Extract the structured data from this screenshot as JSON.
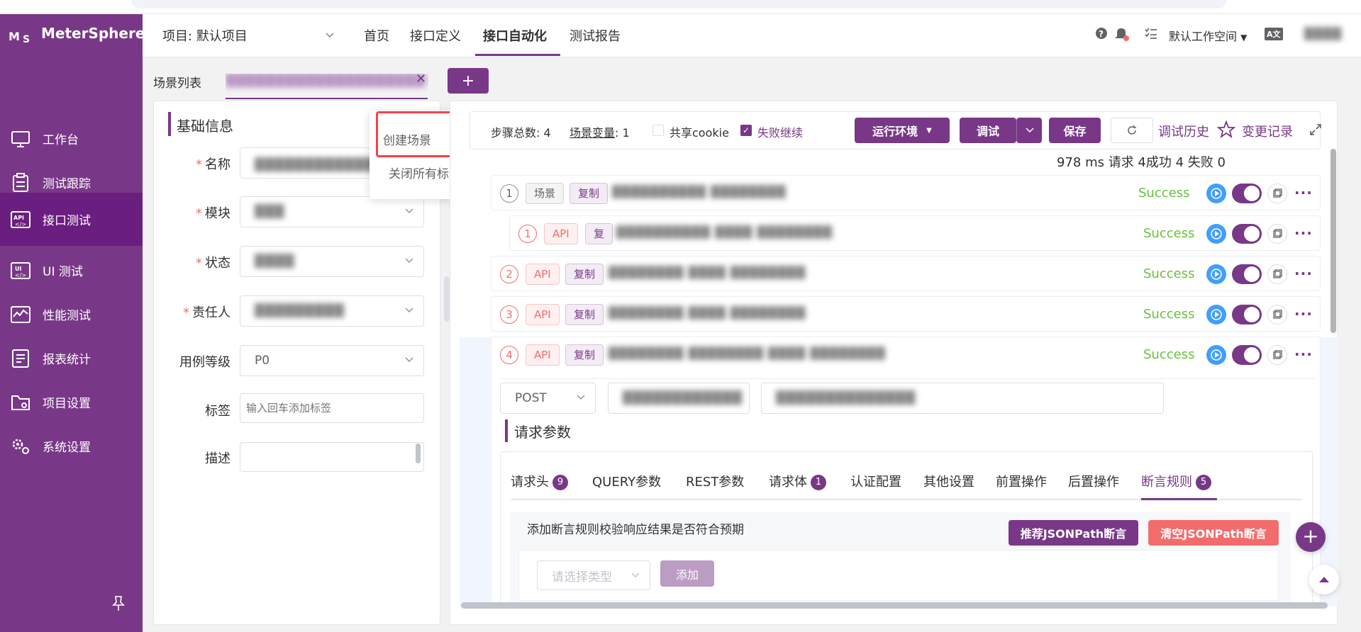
{
  "app": {
    "name": "MeterSphere"
  },
  "topnav": {
    "project": "项目: 默认项目",
    "tabs": [
      "首页",
      "接口定义",
      "接口自动化",
      "测试报告"
    ],
    "active_tab": "接口自动化",
    "workspace": "默认工作空间",
    "lang_icon": "A文",
    "user": "████"
  },
  "sidebar": {
    "items": [
      {
        "label": "工作台",
        "icon": "monitor-icon"
      },
      {
        "label": "测试跟踪",
        "icon": "clipboard-icon"
      },
      {
        "label": "接口测试",
        "icon": "api-icon",
        "active": true
      },
      {
        "label": "UI 测试",
        "icon": "ui-icon"
      },
      {
        "label": "性能测试",
        "icon": "performance-icon"
      },
      {
        "label": "报表统计",
        "icon": "report-icon"
      },
      {
        "label": "项目设置",
        "icon": "folder-icon"
      },
      {
        "label": "系统设置",
        "icon": "settings-icon"
      }
    ]
  },
  "tabs": {
    "scene_list": "场景列表",
    "open_tab_label": "████████████████████3",
    "add": "+"
  },
  "context_menu": {
    "create_scene": "创建场景",
    "close_all": "关闭所有标签"
  },
  "form": {
    "section_title": "基础信息",
    "name_label": "名称",
    "name_value": "████████████提",
    "module_label": "模块",
    "module_value": "███",
    "status_label": "状态",
    "status_value": "████",
    "owner_label": "责任人",
    "owner_value": "█████████",
    "level_label": "用例等级",
    "level_value": "P0",
    "tags_label": "标签",
    "tags_placeholder": "输入回车添加标签",
    "desc_label": "描述"
  },
  "toolbar": {
    "step_total_label": "步骤总数",
    "step_total": "4",
    "scene_var_label": "场景变量",
    "scene_var_count": "1",
    "share_cookie": "共享cookie",
    "share_cookie_checked": false,
    "fail_continue": "失败继续",
    "fail_continue_checked": true,
    "env_button": "运行环境",
    "debug_button": "调试",
    "save_button": "保存",
    "debug_history": "调试历史",
    "change_log": "变更记录",
    "summary": "978 ms 请求 4成功 4 失败 0"
  },
  "steps": [
    {
      "num": "1",
      "type": "场景",
      "copy": "复制",
      "name": "██████████ ████████",
      "status": "Success"
    },
    {
      "num": "1",
      "type": "API",
      "copy": "复",
      "name": "██████████ ████ ████████",
      "status": "Success"
    },
    {
      "num": "2",
      "type": "API",
      "copy": "复制",
      "name": "████████ ████ ████████",
      "status": "Success"
    },
    {
      "num": "3",
      "type": "API",
      "copy": "复制",
      "name": "████████ ████ ████████",
      "status": "Success"
    },
    {
      "num": "4",
      "type": "API",
      "copy": "复制",
      "name": "████████ ████████ ████ ████████",
      "status": "Success"
    }
  ],
  "request": {
    "method": "POST",
    "host": "████████████",
    "path": "██████████████",
    "params_title": "请求参数",
    "tabs": [
      {
        "label": "请求头",
        "badge": "9"
      },
      {
        "label": "QUERY参数"
      },
      {
        "label": "REST参数"
      },
      {
        "label": "请求体",
        "badge": "1"
      },
      {
        "label": "认证配置"
      },
      {
        "label": "其他设置"
      },
      {
        "label": "前置操作"
      },
      {
        "label": "后置操作"
      },
      {
        "label": "断言规则",
        "badge": "5",
        "active": true
      }
    ],
    "assert_hint": "添加断言规则校验响应结果是否符合预期",
    "recommend_btn": "推荐JSONPath断言",
    "clear_btn": "清空JSONPath断言",
    "select_placeholder": "请选择类型",
    "add_btn": "添加"
  },
  "colors": {
    "primary": "#783887",
    "success": "#67c23a",
    "danger": "#f56c6c",
    "info": "#409eff"
  }
}
